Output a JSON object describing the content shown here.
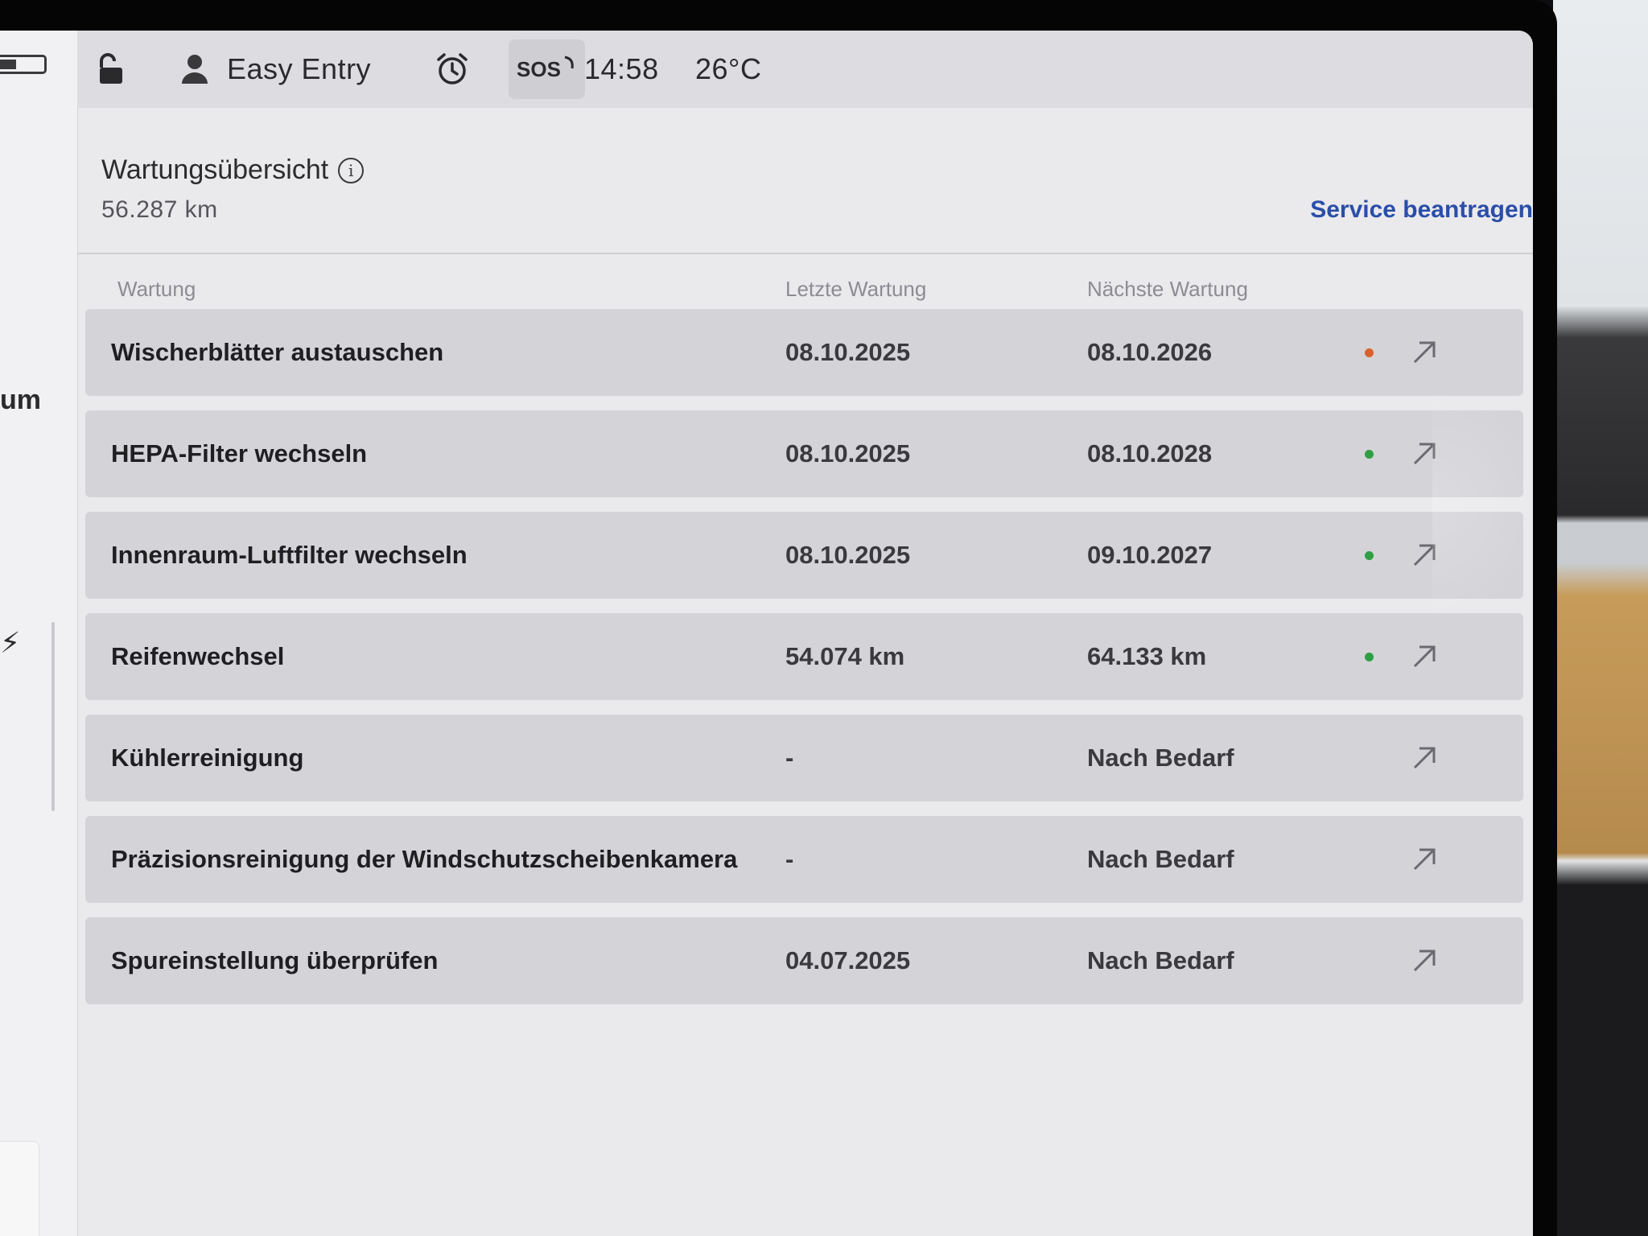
{
  "status_bar": {
    "profile_name": "Easy Entry",
    "sos_label": "SOS",
    "time": "14:58",
    "temperature": "26°C"
  },
  "sidebar_fragment": {
    "label_fragment": "um"
  },
  "header": {
    "title": "Wartungsübersicht",
    "odometer": "56.287  km",
    "service_link": "Service beantragen"
  },
  "table": {
    "headers": {
      "name": "Wartung",
      "last": "Letzte Wartung",
      "next": "Nächste Wartung"
    },
    "rows": [
      {
        "name": "Wischerblätter austauschen",
        "last": "08.10.2025",
        "next": "08.10.2026",
        "status": "due-soon"
      },
      {
        "name": "HEPA-Filter wechseln",
        "last": "08.10.2025",
        "next": "08.10.2028",
        "status": "ok"
      },
      {
        "name": "Innenraum-Luftfilter wechseln",
        "last": "08.10.2025",
        "next": "09.10.2027",
        "status": "ok"
      },
      {
        "name": "Reifenwechsel",
        "last": "54.074 km",
        "next": "64.133 km",
        "status": "ok"
      },
      {
        "name": "Kühlerreinigung",
        "last": "-",
        "next": "Nach Bedarf",
        "status": "none"
      },
      {
        "name": "Präzisionsreinigung der Windschutzscheibenkamera",
        "last": "-",
        "next": "Nach Bedarf",
        "status": "none"
      },
      {
        "name": "Spureinstellung überprüfen",
        "last": "04.07.2025",
        "next": "Nach Bedarf",
        "status": "none"
      }
    ]
  },
  "colors": {
    "accent_link": "#2a4ea8",
    "status_due_soon": "#d9622b",
    "status_ok": "#2ea043"
  },
  "icons": {
    "lock": "unlock-icon",
    "profile": "person-icon",
    "alarm": "alarm-clock-icon",
    "row_action": "arrow-up-right-icon"
  }
}
